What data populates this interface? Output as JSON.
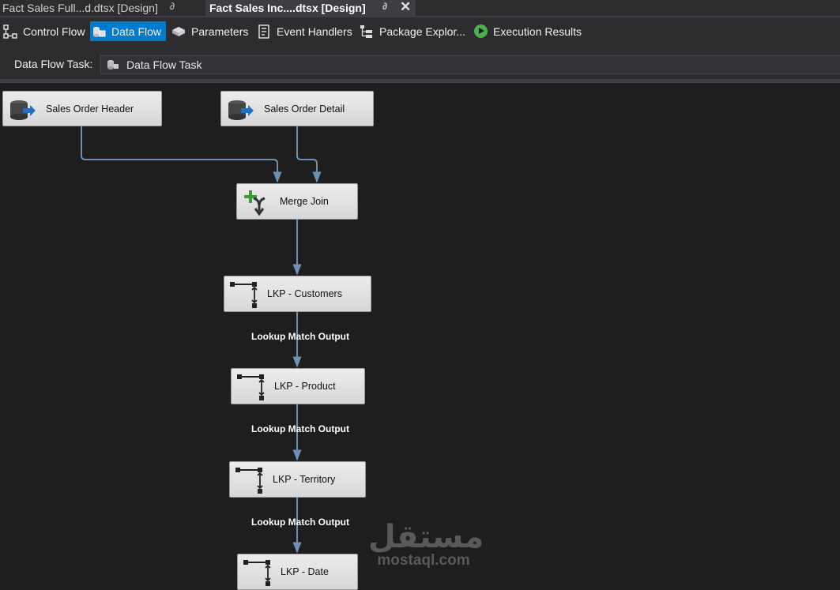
{
  "doc_tabs": [
    {
      "title": "Fact Sales Full...d.dtsx [Design]",
      "pin_glyph": "∂",
      "active": false
    },
    {
      "title": "Fact Sales Inc....dtsx [Design]",
      "pin_glyph": "∂",
      "close_glyph": "✕",
      "active": true
    }
  ],
  "designer_tabs": [
    {
      "label": "Control Flow",
      "icon": "control-flow-icon"
    },
    {
      "label": "Data Flow",
      "icon": "data-flow-icon",
      "selected": true
    },
    {
      "label": "Parameters",
      "icon": "parameters-icon"
    },
    {
      "label": "Event Handlers",
      "icon": "event-handlers-icon"
    },
    {
      "label": "Package Explor...",
      "icon": "package-explorer-icon"
    },
    {
      "label": "Execution Results",
      "icon": "execution-results-icon"
    }
  ],
  "task_selector": {
    "label": "Data Flow Task:",
    "value": "Data Flow Task"
  },
  "components": {
    "sales_order_header": "Sales Order Header",
    "sales_order_detail": "Sales Order Detail",
    "merge_join": "Merge Join",
    "lkp_customers": "LKP - Customers",
    "lkp_product": "LKP - Product",
    "lkp_territory": "LKP - Territory",
    "lkp_date": "LKP - Date"
  },
  "path_labels": {
    "customers_to_product": "Lookup Match Output",
    "product_to_territory": "Lookup Match Output",
    "territory_to_date": "Lookup Match Output"
  },
  "watermark": {
    "arabic": "مستقل",
    "latin": "mostaql.com"
  },
  "colors": {
    "selected_tab": "#007acc",
    "connector": "#6f8fb3",
    "canvas": "#1e1e1e",
    "node_fill": "#e4e4e4"
  }
}
